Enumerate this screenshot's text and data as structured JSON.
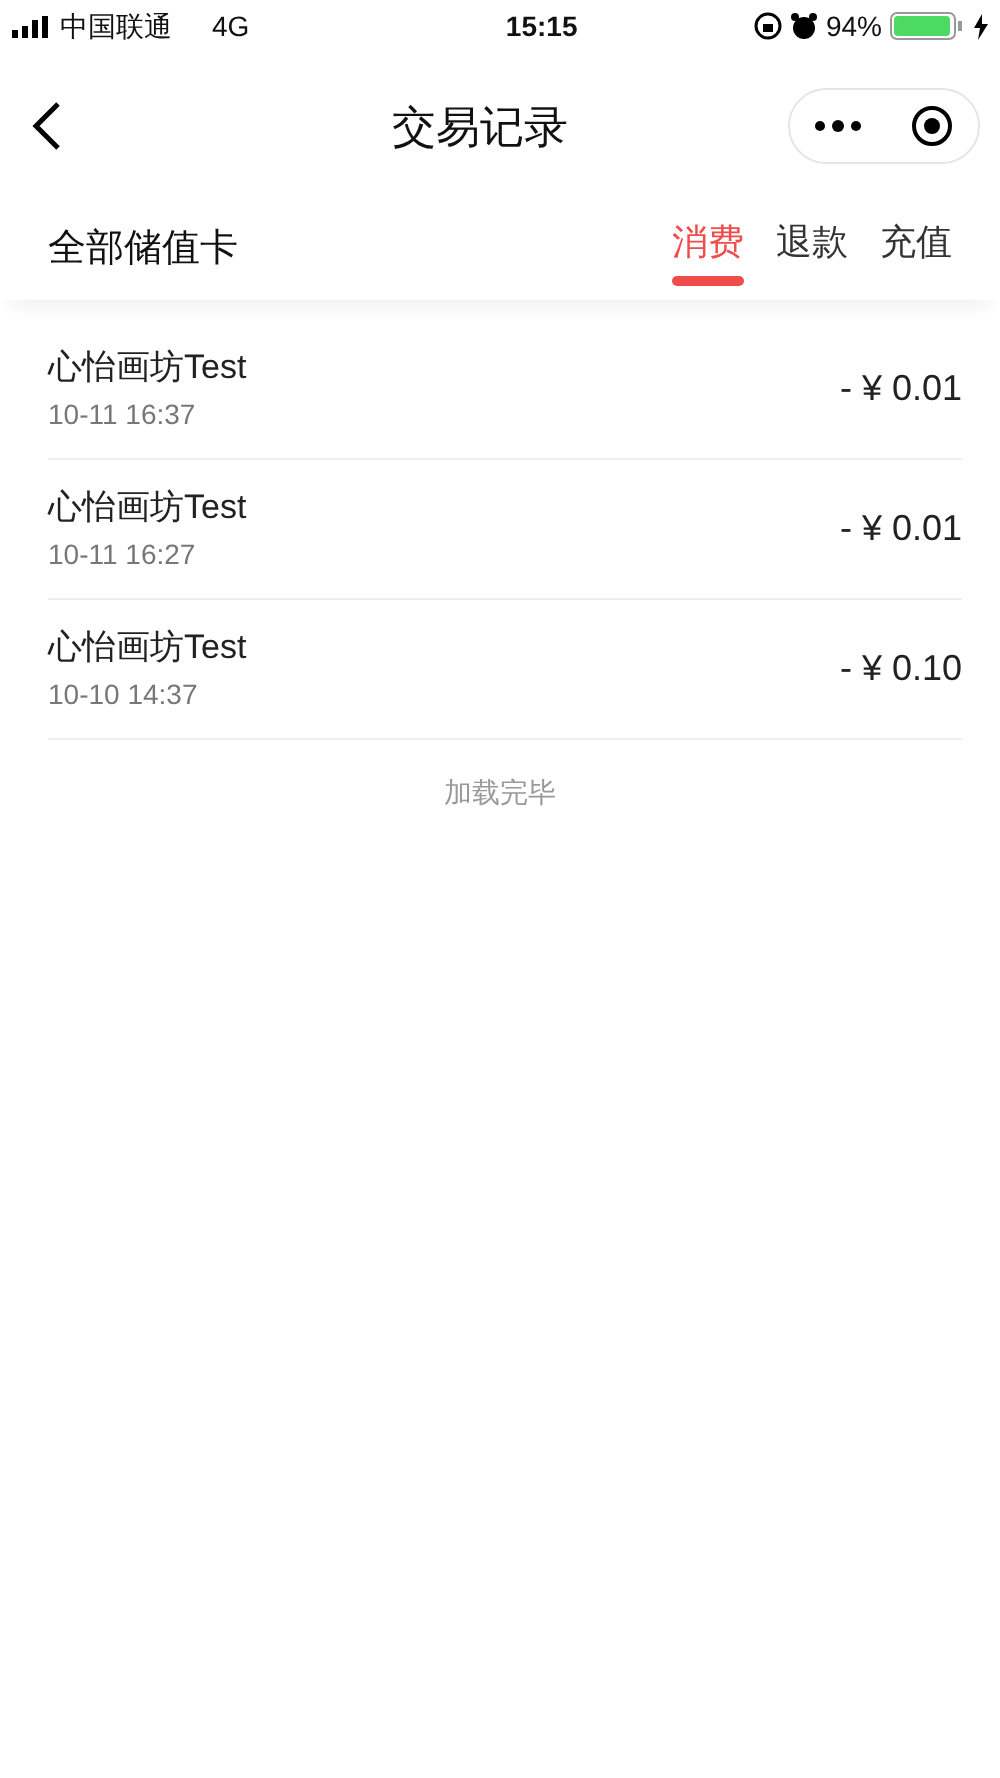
{
  "status_bar": {
    "carrier": "中国联通",
    "network": "4G",
    "time": "15:15",
    "battery": "94%"
  },
  "nav": {
    "title": "交易记录"
  },
  "filter": {
    "label": "全部储值卡",
    "tabs": [
      {
        "label": "消费",
        "selected": true
      },
      {
        "label": "退款",
        "selected": false
      },
      {
        "label": "充值",
        "selected": false
      }
    ]
  },
  "records": [
    {
      "name": "心怡画坊Test",
      "time": "10-11 16:37",
      "amount": "- ¥ 0.01"
    },
    {
      "name": "心怡画坊Test",
      "time": "10-11 16:27",
      "amount": "- ¥ 0.01"
    },
    {
      "name": "心怡画坊Test",
      "time": "10-10 14:37",
      "amount": "- ¥ 0.10"
    }
  ],
  "footer": "加载完毕"
}
